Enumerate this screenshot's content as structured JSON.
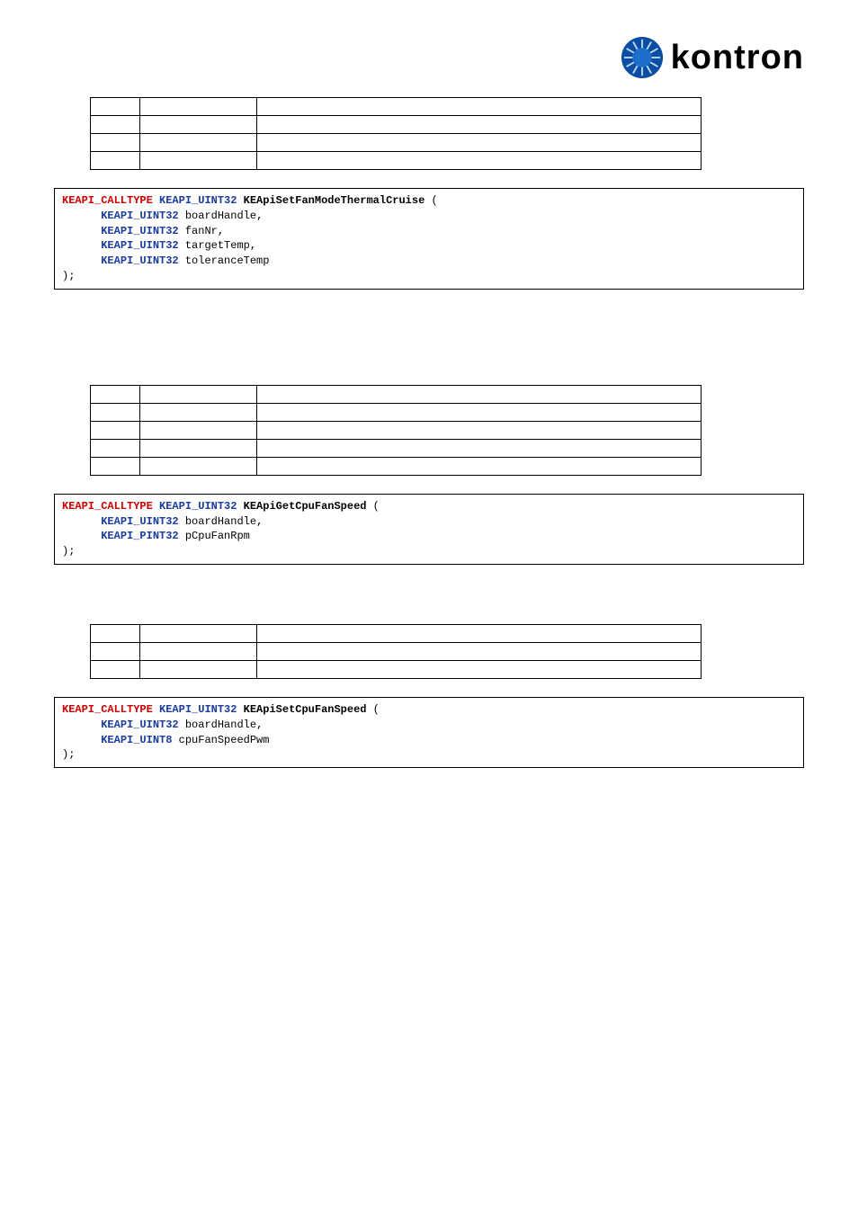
{
  "brand": {
    "name": "kontron"
  },
  "fn1": {
    "calltype": "KEAPI_CALLTYPE",
    "rettype": "KEAPI_UINT32",
    "name": "KEApiSetFanModeThermalCruise",
    "p1type": "KEAPI_UINT32",
    "p1name": "boardHandle",
    "p2type": "KEAPI_UINT32",
    "p2name": "fanNr",
    "p3type": "KEAPI_UINT32",
    "p3name": "targetTemp",
    "p4type": "KEAPI_UINT32",
    "p4name": "toleranceTemp"
  },
  "fn2": {
    "calltype": "KEAPI_CALLTYPE",
    "rettype": "KEAPI_UINT32",
    "name": "KEApiGetCpuFanSpeed",
    "p1type": "KEAPI_UINT32",
    "p1name": "boardHandle",
    "p2type": "KEAPI_PINT32",
    "p2name": "pCpuFanRpm"
  },
  "fn3": {
    "calltype": "KEAPI_CALLTYPE",
    "rettype": "KEAPI_UINT32",
    "name": "KEApiSetCpuFanSpeed",
    "p1type": "KEAPI_UINT32",
    "p1name": "boardHandle",
    "p2type": "KEAPI_UINT8",
    "p2name": "cpuFanSpeedPwm"
  }
}
